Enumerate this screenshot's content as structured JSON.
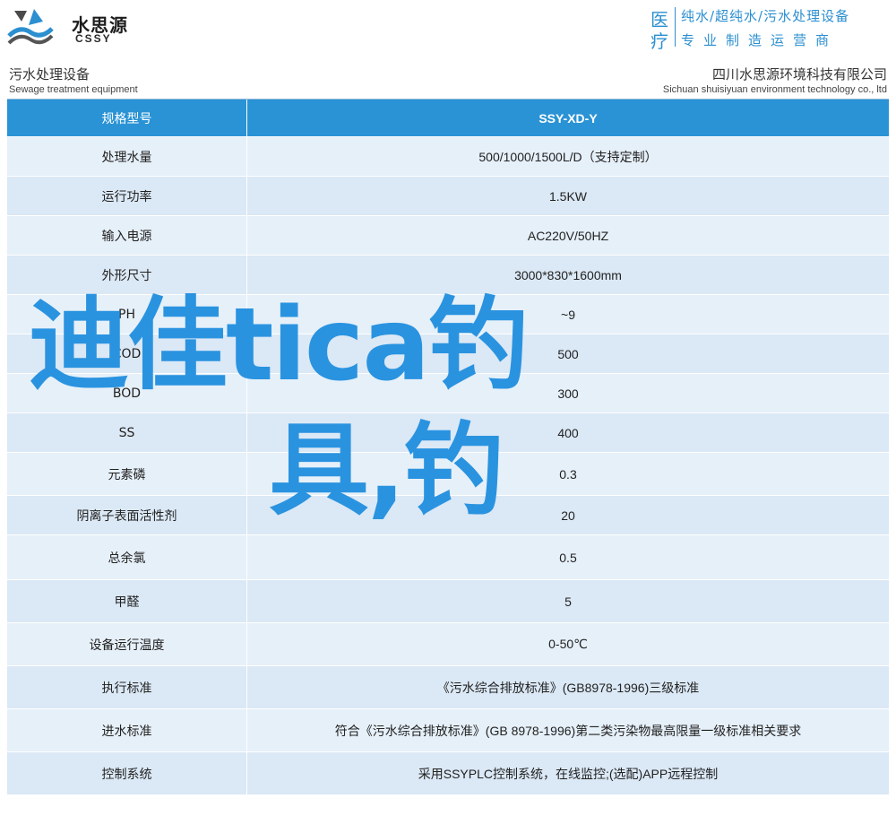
{
  "header": {
    "logo_cn": "水思源",
    "logo_en": "CSSY",
    "side_char_1": "医",
    "side_char_2": "疗",
    "tagline_1": "纯水/超纯水/污水处理设备",
    "tagline_2": "专业制造运营商",
    "brand_color": "#2b8fd0"
  },
  "subheader": {
    "left_cn": "污水处理设备",
    "left_en": "Sewage treatment equipment",
    "right_cn": "四川水思源环境科技有限公司",
    "right_en": "Sichuan shuisiyuan environment technology co., ltd"
  },
  "table": {
    "head": {
      "label": "规格型号",
      "value": "SSY-XD-Y"
    },
    "rows": [
      {
        "label": "处理水量",
        "value": "500/1000/1500L/D（支持定制）"
      },
      {
        "label": "运行功率",
        "value": "1.5KW"
      },
      {
        "label": "输入电源",
        "value": "AC220V/50HZ"
      },
      {
        "label": "外形尺寸",
        "value": "3000*830*1600mm"
      },
      {
        "label": "PH",
        "value": "~9"
      },
      {
        "label": "COD",
        "value": "500"
      },
      {
        "label": "BOD",
        "value": "300"
      },
      {
        "label": "SS",
        "value": "400"
      },
      {
        "label": "元素磷",
        "value": "0.3"
      },
      {
        "label": "阴离子表面活性剂",
        "value": "20"
      },
      {
        "label": "总余氯",
        "value": "0.5"
      },
      {
        "label": "甲醛",
        "value": "5"
      },
      {
        "label": "设备运行温度",
        "value": "0-50℃"
      },
      {
        "label": "执行标准",
        "value": "《污水综合排放标准》(GB8978-1996)三级标准"
      },
      {
        "label": "进水标准",
        "value": "符合《污水综合排放标准》(GB 8978-1996)第二类污染物最高限量一级标准相关要求"
      },
      {
        "label": "控制系统",
        "value": "采用SSYPLC控制系统，在线监控;(选配)APP远程控制"
      }
    ],
    "header_color": "#2a93d5",
    "row_color_a": "#e6f0f9",
    "row_color_b": "#dbe8f5"
  },
  "overlay": {
    "line1": "迪佳tica钓",
    "line2": "具,钓",
    "color": "#2a93e0"
  }
}
